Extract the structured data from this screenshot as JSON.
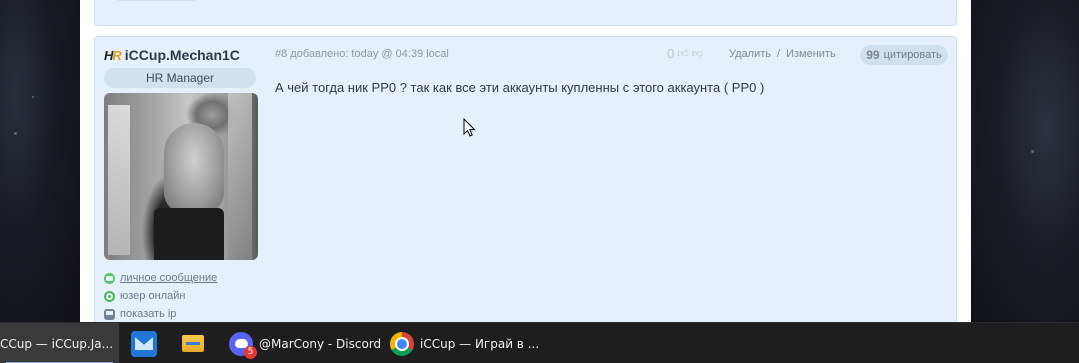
{
  "post": {
    "user": {
      "logo_text": "HR",
      "name": "iCCup.Mechan1C",
      "role": "HR Manager",
      "links": [
        {
          "label": "личное сообщение",
          "icon": "message-icon"
        },
        {
          "label": "юзер онлайн",
          "icon": "online-status-icon"
        },
        {
          "label": "показать ip",
          "icon": "ip-icon"
        }
      ]
    },
    "meta": "#8 добавлено: today @ 04:39 local",
    "rating": "0",
    "actions": {
      "delete": "Удалить",
      "separator": "/",
      "edit": "Изменить"
    },
    "quote": {
      "glyph": "99",
      "label": "цитировать"
    },
    "text": "А чей тогда ник РР0 ? так как все эти аккаунты купленны с этого аккаунта ( РР0 )"
  },
  "taskbar": {
    "items": [
      {
        "label": "CCup — iCCup.Ja...",
        "icon": "window-icon",
        "active": true
      },
      {
        "label": "",
        "icon": "mail-icon"
      },
      {
        "label": "",
        "icon": "folder-icon"
      },
      {
        "label": "@MarCony - Discord",
        "icon": "discord-icon",
        "badge": "5"
      },
      {
        "label": "iCCup — Играй в ...",
        "icon": "chrome-icon"
      }
    ]
  },
  "colors": {
    "post_bg": "#e5f0fa",
    "badge_bg": "#d3e1ef",
    "online_green": "#49b85b",
    "taskbar_bg": "#1e1e1e"
  }
}
